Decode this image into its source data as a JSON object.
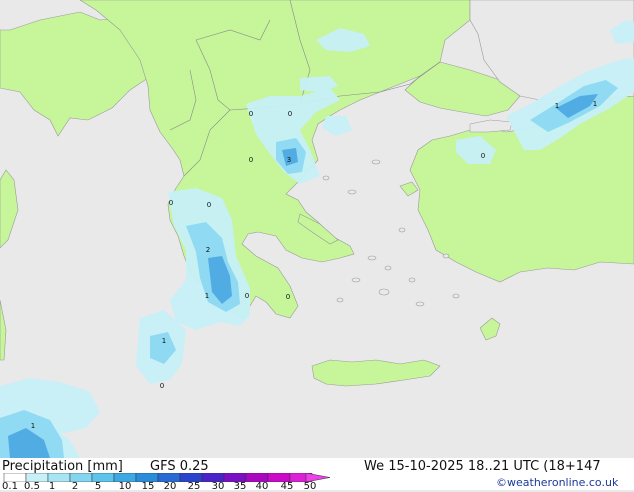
{
  "title": "Precipitation [mm]",
  "model": "GFS 0.25",
  "valid_time": "We 15-10-2025 18..21 UTC (18+147",
  "credit": "©weatheronline.co.uk",
  "legend": {
    "ticks": [
      "0.1",
      "0.5",
      "1",
      "2",
      "5",
      "10",
      "15",
      "20",
      "25",
      "30",
      "35",
      "40",
      "45",
      "50"
    ],
    "colors": [
      "#ffffff",
      "#c8f0f8",
      "#a8e4f4",
      "#84d6f0",
      "#5ec4ec",
      "#3ea8e4",
      "#2c8cdc",
      "#2a6ad4",
      "#2a44cc",
      "#4a24c8",
      "#7a10c4",
      "#aa08c0",
      "#cc08c8",
      "#dc20d8",
      "#ec40e8"
    ]
  },
  "colors": {
    "sea": "#e9e9e9",
    "land": "#c6f59a",
    "border": "#9a9a9a"
  },
  "map_labels": [
    "0",
    "0",
    "0",
    "3",
    "0",
    "0",
    "2",
    "1",
    "0",
    "0",
    "1",
    "0",
    "1",
    "1",
    "1",
    "0"
  ]
}
